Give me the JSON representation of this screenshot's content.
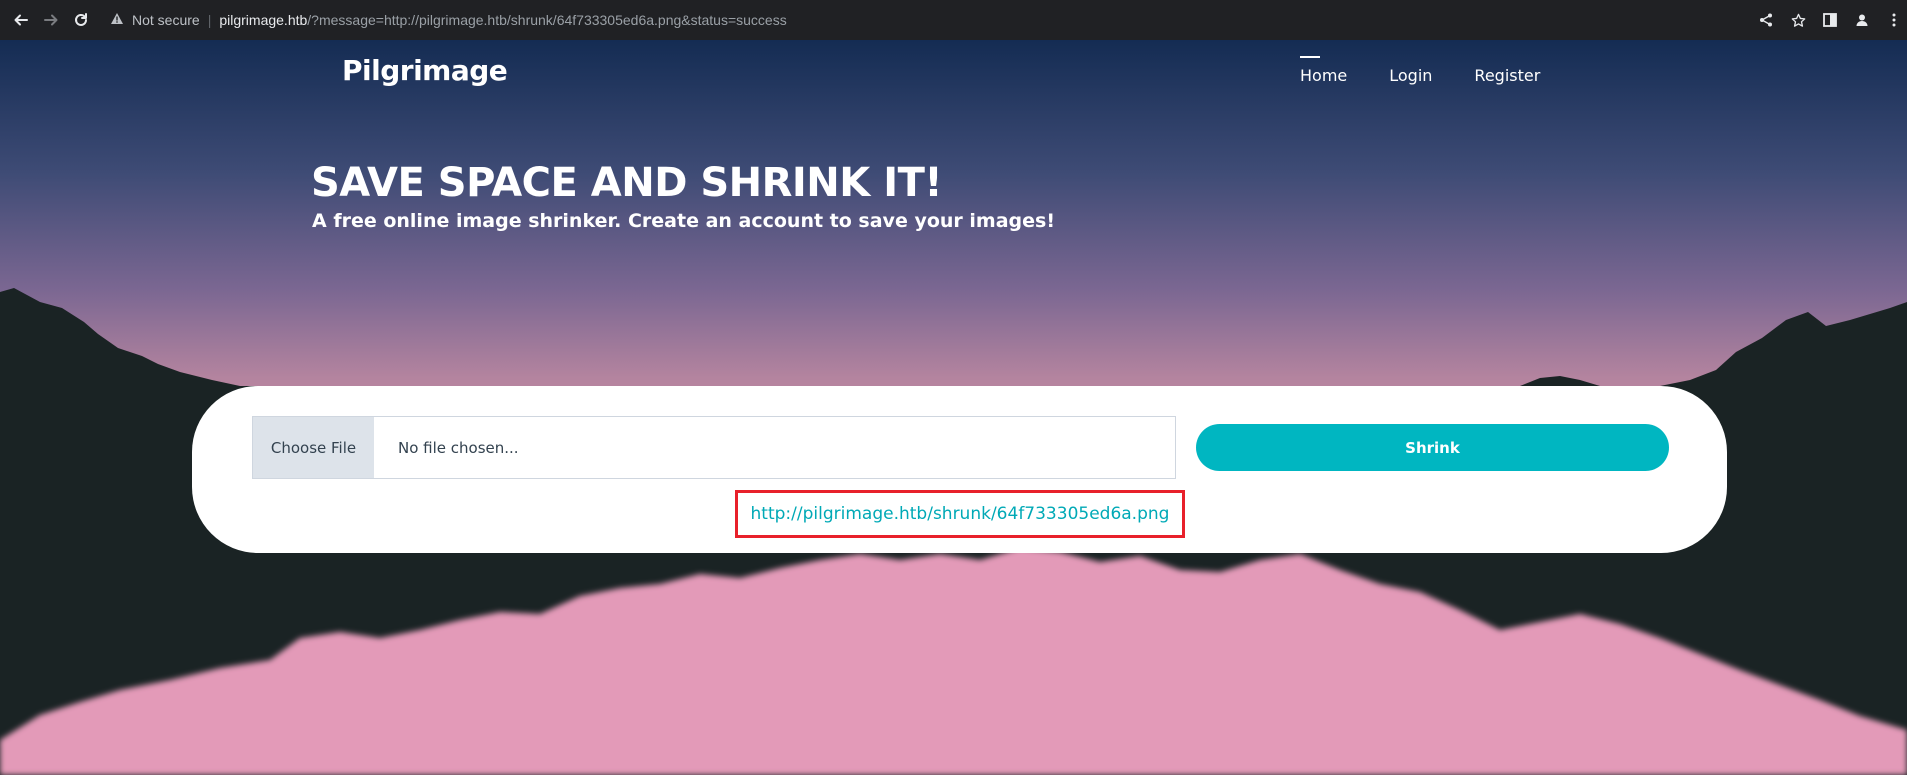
{
  "browser": {
    "security_label": "Not secure",
    "url_host": "pilgrimage.htb",
    "url_path": "/?message=http://pilgrimage.htb/shrunk/64f733305ed6a.png&status=success",
    "icons": [
      "back-icon",
      "forward-icon",
      "reload-icon",
      "warning-icon",
      "share-icon",
      "star-icon",
      "side-panel-icon",
      "profile-icon",
      "menu-icon"
    ]
  },
  "site": {
    "brand": "Pilgrimage",
    "nav": [
      {
        "label": "Home",
        "active": true
      },
      {
        "label": "Login",
        "active": false
      },
      {
        "label": "Register",
        "active": false
      }
    ]
  },
  "hero": {
    "title": "SAVE SPACE AND SHRINK IT!",
    "subtitle": "A free online image shrinker. Create an account to save your images!"
  },
  "upload": {
    "choose_file_label": "Choose File",
    "file_placeholder": "No file chosen...",
    "submit_label": "Shrink"
  },
  "result": {
    "link_text": "http://pilgrimage.htb/shrunk/64f733305ed6a.png"
  },
  "colors": {
    "accent": "#00b6c1",
    "highlight_border": "#e8202a",
    "mountain_dark": "#1a2324",
    "reflection_pink": "#e39ab8"
  }
}
